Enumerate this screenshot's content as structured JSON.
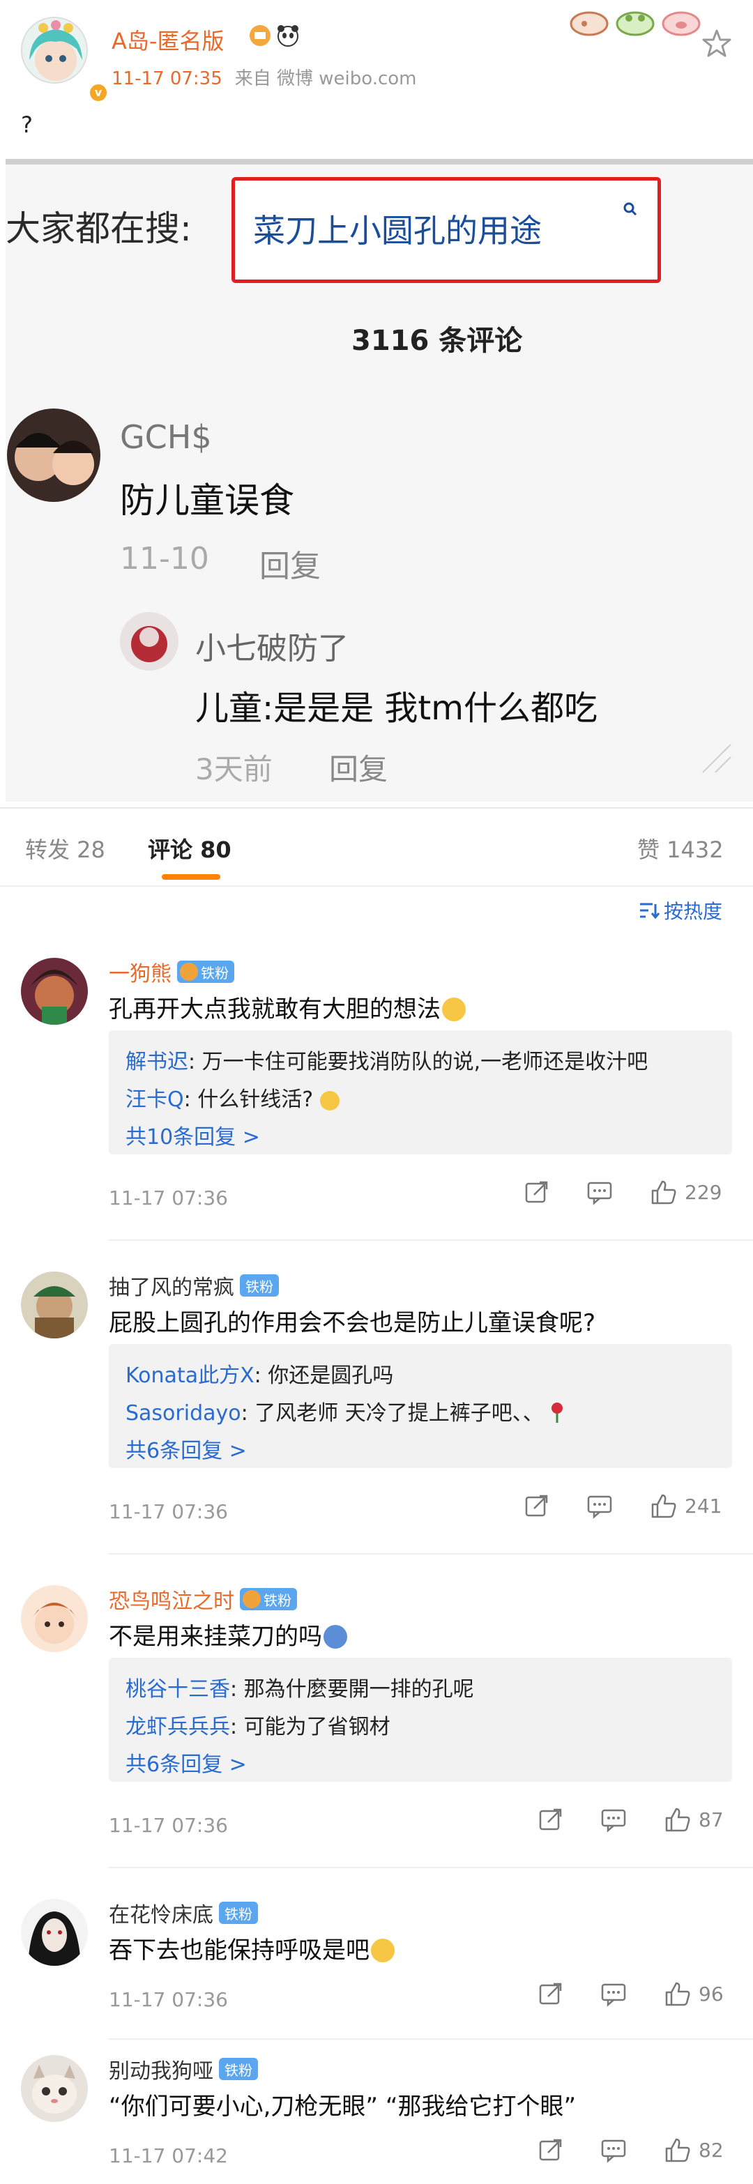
{
  "post": {
    "author_name": "A岛-匿名版",
    "time": "11-17 07:35",
    "source": "来自 微博 weibo.com",
    "text": "?"
  },
  "screenshot": {
    "search_prefix": "大家都在搜:",
    "search_query": "菜刀上小圆孔的用途",
    "comment_count": "3116 条评论",
    "comment1": {
      "user": "GCH$",
      "text": "防儿童误食",
      "time": "11-10",
      "reply": "回复"
    },
    "comment2": {
      "user": "小七破防了",
      "text": "儿童:是是是 我tm什么都吃",
      "time": "3天前",
      "reply": "回复"
    }
  },
  "tabs": {
    "repost": "转发 28",
    "comments": "评论 80",
    "likes": "赞 1432"
  },
  "sort_label": "按热度",
  "colors": {
    "accent": "#ff8200",
    "link": "#2a6bd0",
    "username": "#e86a2b"
  },
  "comments": [
    {
      "user": "一狗熊",
      "badge": "铁粉",
      "text": "孔再开大点我就敢有大胆的想法",
      "replies": [
        {
          "name": "解书迟",
          "text": ": 万一卡住可能要找消防队的说,一老师还是收汁吧"
        },
        {
          "name": "汪卡Q",
          "text": ": 什么针线活?"
        }
      ],
      "more": "共10条回复 >",
      "time": "11-17 07:36",
      "likes": "229"
    },
    {
      "user": "抽了风的常疯",
      "badge": "铁粉",
      "text": "屁股上圆孔的作用会不会也是防止儿童误食呢?",
      "replies": [
        {
          "name": "Konata此方X",
          "text": ": 你还是圆孔吗"
        },
        {
          "name": "Sasoridayo",
          "text": ": 了风老师 天冷了提上裤子吧、、"
        }
      ],
      "more": "共6条回复 >",
      "time": "11-17 07:36",
      "likes": "241"
    },
    {
      "user": "恐鸟鸣泣之时",
      "badge": "铁粉",
      "text": "不是用来挂菜刀的吗",
      "replies": [
        {
          "name": "桃谷十三香",
          "text": ": 那為什麼要開一排的孔呢"
        },
        {
          "name": "龙虾兵兵兵",
          "text": ": 可能为了省钢材"
        }
      ],
      "more": "共6条回复 >",
      "time": "11-17 07:36",
      "likes": "87"
    },
    {
      "user": "在花怜床底",
      "badge": "铁粉",
      "text": "吞下去也能保持呼吸是吧",
      "time": "11-17 07:36",
      "likes": "96"
    },
    {
      "user": "别动我狗哑",
      "badge": "铁粉",
      "text": "“你们可要小心,刀枪无眼” “那我给它打个眼”",
      "time": "11-17 07:42",
      "likes": "82"
    }
  ]
}
